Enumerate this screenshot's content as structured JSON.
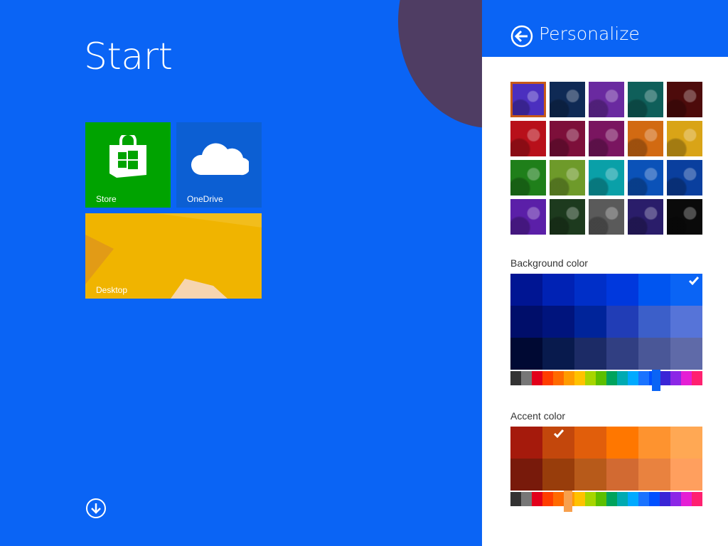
{
  "start": {
    "title": "Start",
    "tiles": [
      {
        "label": "Store",
        "color": "#00a300"
      },
      {
        "label": "OneDrive",
        "color": "#0c5fd3"
      },
      {
        "label": "Desktop",
        "color": "#f0b400"
      }
    ],
    "apps_icon": "down-arrow-circle-icon"
  },
  "panel": {
    "title": "Personalize",
    "back_icon": "back-arrow-icon",
    "background_label": "Background color",
    "accent_label": "Accent color",
    "background_patterns": [
      "#4b2fbf",
      "#0f2a55",
      "#6a2aa0",
      "#0f5f5a",
      "#4d0b0b",
      "#b8101a",
      "#7d0f3a",
      "#7a1560",
      "#d26a12",
      "#d9a417",
      "#1f7f1a",
      "#6e9a2a",
      "#0aa0a8",
      "#0b52b8",
      "#0a3f9e",
      "#5b1fa8",
      "#1d3a1e",
      "#5a5a5a",
      "#2a1d6a",
      "#0a0a0a"
    ],
    "background_selected_pattern": 0,
    "background_palette": [
      [
        "#001593",
        "#0022b4",
        "#002fc8",
        "#0038dd",
        "#0055f0",
        "#0a64f5"
      ],
      [
        "#000e6a",
        "#00147d",
        "#00249a",
        "#213db6",
        "#3c5fc9",
        "#5674d8"
      ],
      [
        "#000933",
        "#081a4d",
        "#1c2b66",
        "#313f82",
        "#4a5797",
        "#5f6aa8"
      ]
    ],
    "background_selected": "0,5",
    "accent_palette": [
      [
        "#a51a0c",
        "#c3470c",
        "#e15e0b",
        "#ff7700",
        "#fe932f",
        "#ffa854"
      ],
      [
        "#781a0b",
        "#983d0b",
        "#b75a1a",
        "#d26a32",
        "#e9823f",
        "#ff9f5e"
      ]
    ],
    "accent_selected": "0,1",
    "hue_stops": [
      "#333333",
      "#777777",
      "#e2001a",
      "#ff3d00",
      "#ff6a00",
      "#ff9b00",
      "#ffc200",
      "#a7d500",
      "#5cbf00",
      "#00a35c",
      "#00aab1",
      "#00aaff",
      "#1a73ff",
      "#0050ff",
      "#3a25d6",
      "#8c27e6",
      "#e51fd4",
      "#ff2070"
    ],
    "bg_hue_position": 0.76,
    "accent_hue_position": 0.3
  }
}
